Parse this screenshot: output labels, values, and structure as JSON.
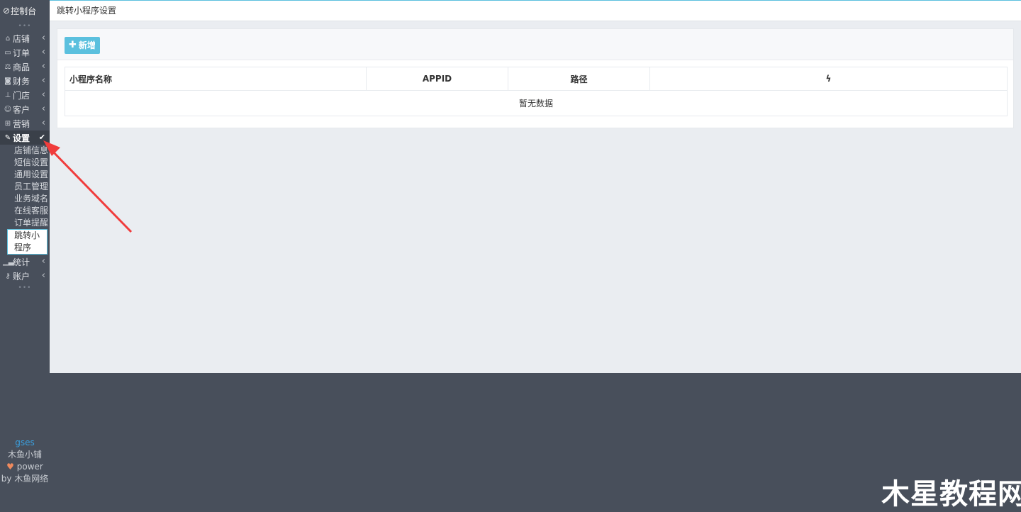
{
  "sidebar": {
    "top": {
      "label": "控制台",
      "icon": "dashboard-icon"
    },
    "items": [
      {
        "label": "店铺",
        "icon": "shop-icon"
      },
      {
        "label": "订单",
        "icon": "order-icon"
      },
      {
        "label": "商品",
        "icon": "scale-icon"
      },
      {
        "label": "财务",
        "icon": "money-icon"
      },
      {
        "label": "门店",
        "icon": "sitemap-icon"
      },
      {
        "label": "客户",
        "icon": "users-icon"
      },
      {
        "label": "营销",
        "icon": "gift-icon"
      },
      {
        "label": "设置",
        "icon": "wrench-icon"
      },
      {
        "label": "统计",
        "icon": "signal-icon"
      },
      {
        "label": "账户",
        "icon": "key-icon"
      }
    ],
    "submenu": [
      "店铺信息",
      "短信设置",
      "通用设置",
      "员工管理",
      "业务域名",
      "在线客服",
      "订单提醒",
      "跳转小程序"
    ],
    "footer": {
      "username": "gses",
      "shop": "木鱼小铺",
      "power": "power",
      "by": "by",
      "company": "木鱼网络"
    }
  },
  "header": {
    "title": "跳转小程序设置"
  },
  "toolbar": {
    "add_label": "新增"
  },
  "table": {
    "columns": [
      "小程序名称",
      "APPID",
      "路径",
      "ϟ"
    ],
    "empty_text": "暂无数据"
  },
  "watermark": "木星教程网",
  "colors": {
    "accent": "#5bc0de",
    "sidebar": "#484f5b",
    "arrow": "#f03c3c"
  }
}
